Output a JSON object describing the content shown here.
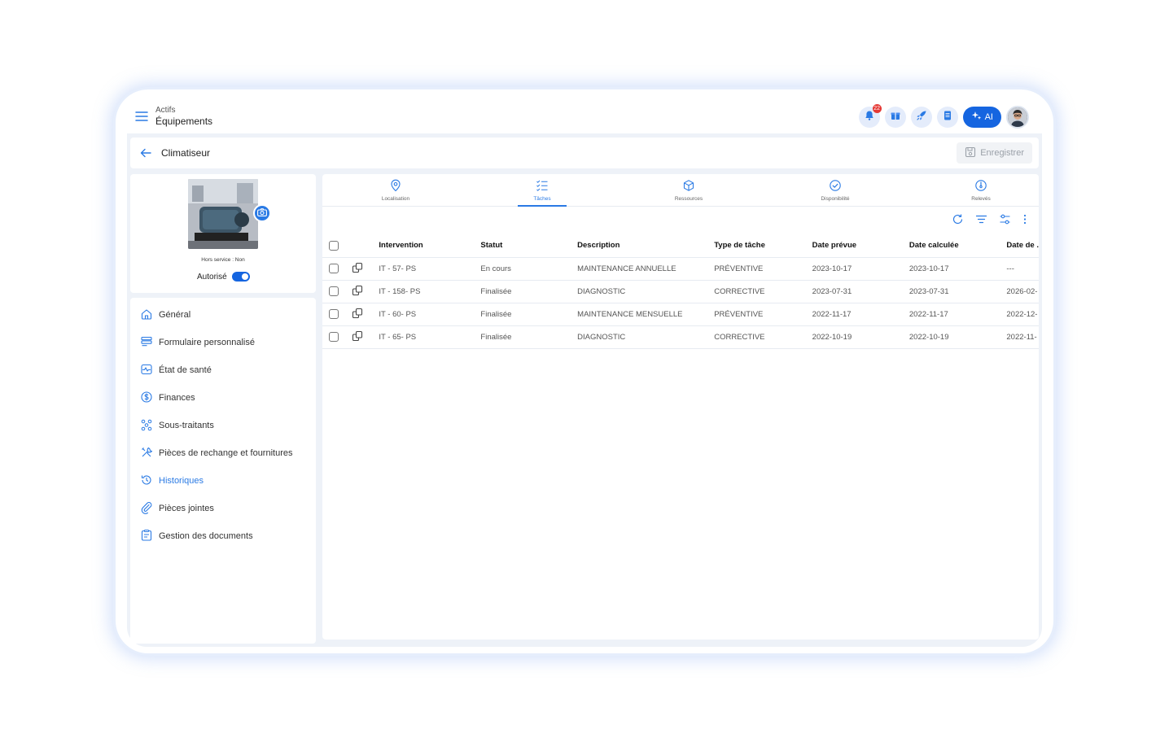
{
  "header": {
    "breadcrumb_parent": "Actifs",
    "breadcrumb_current": "Équipements",
    "notification_count": "22",
    "ai_label": "AI",
    "icons": [
      "bell-icon",
      "gift-icon",
      "rocket-icon",
      "book-icon"
    ]
  },
  "titlebar": {
    "title": "Climatiseur",
    "save_label": "Enregistrer"
  },
  "equipment": {
    "out_of_service": "Hors service : Non",
    "authorized_label": "Autorisé",
    "authorized": true
  },
  "nav": {
    "items": [
      {
        "label": "Général",
        "icon": "home-icon"
      },
      {
        "label": "Formulaire personnalisé",
        "icon": "form-icon"
      },
      {
        "label": "État de santé",
        "icon": "health-icon"
      },
      {
        "label": "Finances",
        "icon": "dollar-icon"
      },
      {
        "label": "Sous-traitants",
        "icon": "contractors-icon"
      },
      {
        "label": "Pièces de rechange et fournitures",
        "icon": "tools-icon"
      },
      {
        "label": "Historiques",
        "icon": "history-icon"
      },
      {
        "label": "Pièces jointes",
        "icon": "paperclip-icon"
      },
      {
        "label": "Gestion des documents",
        "icon": "document-icon"
      }
    ],
    "active_index": 6
  },
  "tabs": [
    {
      "label": "Localisation",
      "icon": "location-icon"
    },
    {
      "label": "Tâches",
      "icon": "tasks-icon"
    },
    {
      "label": "Ressources",
      "icon": "cube-icon"
    },
    {
      "label": "Disponibilité",
      "icon": "check-circle-icon"
    },
    {
      "label": "Relevés",
      "icon": "gauge-icon"
    }
  ],
  "active_tab": 1,
  "table": {
    "columns": [
      "Intervention",
      "Statut",
      "Description",
      "Type de tâche",
      "Date prévue",
      "Date calculée",
      "Date de ."
    ],
    "rows": [
      [
        "IT - 57- PS",
        "En cours",
        "MAINTENANCE ANNUELLE",
        "PRÉVENTIVE",
        "2023-10-17",
        "2023-10-17",
        "---"
      ],
      [
        "IT - 158- PS",
        "Finalisée",
        "DIAGNOSTIC",
        "CORRECTIVE",
        "2023-07-31",
        "2023-07-31",
        "2026-02-"
      ],
      [
        "IT - 60- PS",
        "Finalisée",
        "MAINTENANCE MENSUELLE",
        "PRÉVENTIVE",
        "2022-11-17",
        "2022-11-17",
        "2022-12-"
      ],
      [
        "IT - 65- PS",
        "Finalisée",
        "DIAGNOSTIC",
        "CORRECTIVE",
        "2022-10-19",
        "2022-10-19",
        "2022-11-"
      ]
    ]
  },
  "colors": {
    "accent": "#2a7ae4",
    "primary": "#1565e0",
    "background": "#eef2f8",
    "badge": "#e53935"
  }
}
